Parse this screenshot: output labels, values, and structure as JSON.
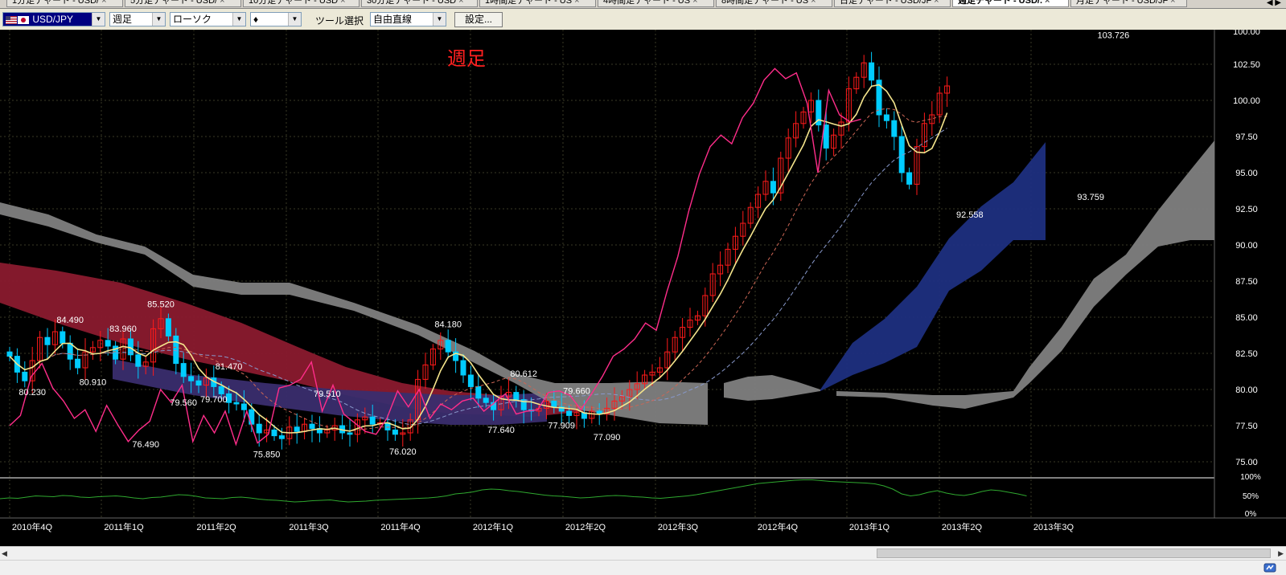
{
  "tabs": [
    {
      "label": "1分足チャート - USD/",
      "active": false
    },
    {
      "label": "5分足チャート - USD/",
      "active": false
    },
    {
      "label": "10分足チャート - USD",
      "active": false
    },
    {
      "label": "30分足チャート - USD",
      "active": false
    },
    {
      "label": "1時間足チャート - US",
      "active": false
    },
    {
      "label": "4時間足チャート - US",
      "active": false
    },
    {
      "label": "8時間足チャート - US",
      "active": false
    },
    {
      "label": "日足チャート - USD/JF",
      "active": false
    },
    {
      "label": "週足チャート - USD/.",
      "active": true
    },
    {
      "label": "月足チャート - USD/JF",
      "active": false
    }
  ],
  "tab_close": "×",
  "tab_nav": "◀ ▶",
  "toolbar": {
    "symbol": "USD/JPY",
    "timeframe": "週足",
    "chart_type": "ローソク",
    "candle_glyph": "♦",
    "tool_label": "ツール選択",
    "tool_value": "自由直線",
    "settings_label": "設定..."
  },
  "colors": {
    "background": "#000000",
    "grid": "#3a3a26",
    "bull": "#ff1a1a",
    "bear": "#00ccff",
    "cloud_bear": "#8a1a2e",
    "cloud_bull": "#1e2f80",
    "cloud_future": "#808080",
    "ma": "#f5e58c",
    "rsi": "#ff2d8a",
    "volume_line": "#2fa82f",
    "title": "#ff2020"
  },
  "chart": {
    "title": "週足",
    "price_axis": [
      "100.00",
      "102.50",
      "100.00",
      "97.50",
      "95.00",
      "92.50",
      "90.00",
      "87.50",
      "85.00",
      "82.50",
      "80.00",
      "77.50",
      "75.00"
    ],
    "price_axis_values": [
      105.0,
      102.5,
      100.0,
      97.5,
      95.0,
      92.5,
      90.0,
      87.5,
      85.0,
      82.5,
      80.0,
      77.5,
      75.0
    ],
    "indicator_axis": [
      "100%",
      "50%",
      "0%"
    ],
    "time_axis": [
      "2010年4Q",
      "2011年1Q",
      "2011年2Q",
      "2011年3Q",
      "2011年4Q",
      "2012年1Q",
      "2012年2Q",
      "2012年3Q",
      "2012年4Q",
      "2013年1Q",
      "2013年2Q",
      "2013年3Q"
    ],
    "price_labels": [
      {
        "text": "103.726",
        "week": 146,
        "price": 104.3
      },
      {
        "text": "84.490",
        "week": 8,
        "price": 84.6
      },
      {
        "text": "85.520",
        "week": 20,
        "price": 85.7
      },
      {
        "text": "83.960",
        "week": 15,
        "price": 84.0
      },
      {
        "text": "84.180",
        "week": 58,
        "price": 84.3
      },
      {
        "text": "80.230",
        "week": 3,
        "price": 79.6
      },
      {
        "text": "80.910",
        "week": 11,
        "price": 80.3
      },
      {
        "text": "76.490",
        "week": 18,
        "price": 76.0
      },
      {
        "text": "79.560",
        "week": 23,
        "price": 78.9
      },
      {
        "text": "79.700",
        "week": 27,
        "price": 79.1
      },
      {
        "text": "81.470",
        "week": 29,
        "price": 81.4
      },
      {
        "text": "75.850",
        "week": 34,
        "price": 75.3
      },
      {
        "text": "79.510",
        "week": 42,
        "price": 79.5
      },
      {
        "text": "76.020",
        "week": 52,
        "price": 75.5
      },
      {
        "text": "77.640",
        "week": 65,
        "price": 77.0
      },
      {
        "text": "80.612",
        "week": 68,
        "price": 80.9
      },
      {
        "text": "79.660",
        "week": 75,
        "price": 79.7
      },
      {
        "text": "77.909",
        "week": 73,
        "price": 77.3
      },
      {
        "text": "77.090",
        "week": 79,
        "price": 76.5
      },
      {
        "text": "92.558",
        "week": 127,
        "price": 91.9
      },
      {
        "text": "93.759",
        "week": 143,
        "price": 93.1
      }
    ]
  },
  "chart_data": {
    "type": "candlestick",
    "title": "週足",
    "ylim": [
      75.0,
      105.0
    ],
    "x_ticks": [
      "2010年4Q",
      "2011年1Q",
      "2011年2Q",
      "2011年3Q",
      "2011年4Q",
      "2012年1Q",
      "2012年2Q",
      "2012年3Q",
      "2012年4Q",
      "2013年1Q",
      "2013年2Q",
      "2013年3Q"
    ],
    "indicator_ylim": [
      0,
      100
    ],
    "closes": [
      82.3,
      81.2,
      80.6,
      82.0,
      83.6,
      83.1,
      84.0,
      83.2,
      82.1,
      81.5,
      82.6,
      82.9,
      83.4,
      83.0,
      82.1,
      83.5,
      82.4,
      81.6,
      81.9,
      84.2,
      84.9,
      83.7,
      81.8,
      80.9,
      80.6,
      80.3,
      80.8,
      80.2,
      79.7,
      79.1,
      79.0,
      78.6,
      77.6,
      77.0,
      77.2,
      76.8,
      76.6,
      77.4,
      77.1,
      77.6,
      77.3,
      77.0,
      77.2,
      77.5,
      77.0,
      76.9,
      77.9,
      78.1,
      77.6,
      77.7,
      77.2,
      76.9,
      77.0,
      77.9,
      80.7,
      81.7,
      82.8,
      83.4,
      82.6,
      82.0,
      81.0,
      80.2,
      79.4,
      79.1,
      78.6,
      79.5,
      79.8,
      79.3,
      78.6,
      78.5,
      78.7,
      79.2,
      78.8,
      78.5,
      78.2,
      78.4,
      78.0,
      78.5,
      78.3,
      78.7,
      79.2,
      79.5,
      80.0,
      80.4,
      81.0,
      81.2,
      81.5,
      82.6,
      83.6,
      84.3,
      84.8,
      85.1,
      86.5,
      88.0,
      88.6,
      89.7,
      90.6,
      91.5,
      92.6,
      93.5,
      94.4,
      93.6,
      96.0,
      97.4,
      98.4,
      99.2,
      100.0,
      98.3,
      96.7,
      97.6,
      98.5,
      100.8,
      101.6,
      102.6,
      101.4,
      99.0,
      98.6,
      97.5,
      95.0,
      94.2,
      96.8,
      98.4,
      99.0,
      100.5,
      101.0
    ],
    "rsi": [
      77.5,
      78.2,
      80.9,
      81.8,
      80.1,
      79.2,
      78.0,
      78.6,
      77.1,
      78.9,
      77.6,
      76.4,
      77.2,
      77.8,
      80.0,
      79.1,
      80.3,
      76.4,
      78.2,
      77.0,
      78.5,
      76.2,
      78.5,
      76.3,
      76.9,
      80.1,
      80.3,
      80.7,
      81.9,
      78.5,
      80.3,
      78.3,
      77.7,
      77.1,
      76.9,
      78.0,
      79.9,
      78.8,
      80.0,
      78.0,
      79.0,
      78.6,
      79.2,
      79.4,
      78.5,
      79.1,
      79.7,
      78.3,
      78.5,
      78.6,
      79.8,
      79.9,
      79.6,
      78.6,
      79.7,
      80.9,
      82.3,
      82.8,
      83.5,
      84.6,
      84.1,
      86.8,
      89.2,
      92.3,
      94.9,
      96.8,
      97.6,
      97.0,
      98.8,
      99.8,
      101.4,
      102.2,
      101.5,
      101.9,
      99.8,
      95.0,
      100.7,
      99.0,
      98.5,
      98.7
    ],
    "volume_pct": [
      48,
      50,
      49,
      52,
      55,
      54,
      53,
      56,
      55,
      52,
      51,
      53,
      54,
      55,
      53,
      50,
      48,
      51,
      52,
      55,
      58,
      57,
      54,
      50,
      49,
      48,
      51,
      52,
      50,
      47,
      45,
      44,
      42,
      40,
      41,
      43,
      44,
      45,
      42,
      40,
      41,
      42,
      44,
      45,
      46,
      47,
      48,
      49,
      50,
      52,
      55,
      60,
      62,
      65,
      70,
      72,
      71,
      68,
      66,
      63,
      60,
      57,
      55,
      54,
      52,
      50,
      51,
      53,
      55,
      56,
      55,
      53,
      52,
      50,
      49,
      51,
      53,
      55,
      58,
      62,
      66,
      70,
      74,
      78,
      82,
      86,
      88,
      90,
      92,
      94,
      95,
      95,
      93,
      91,
      90,
      89,
      88,
      87,
      85,
      80,
      72,
      60,
      55,
      58,
      64,
      68,
      62,
      58,
      56,
      60,
      66,
      70,
      68,
      64,
      60,
      55
    ]
  }
}
